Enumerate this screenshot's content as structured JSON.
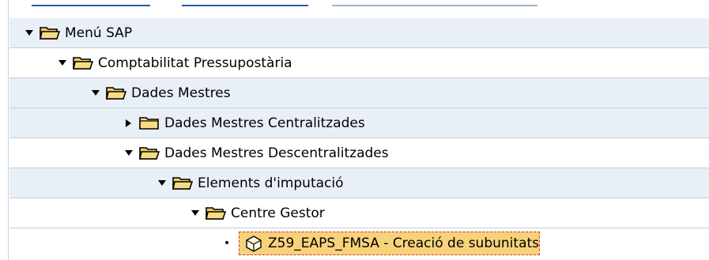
{
  "tree": {
    "items": [
      {
        "label": "Menú SAP",
        "state": "expanded",
        "icon": "folder-open-icon"
      },
      {
        "label": "Comptabilitat Pressupostària",
        "state": "expanded",
        "icon": "folder-open-icon"
      },
      {
        "label": "Dades Mestres",
        "state": "expanded",
        "icon": "folder-open-icon"
      },
      {
        "label": "Dades Mestres Centralitzades",
        "state": "collapsed",
        "icon": "folder-closed-icon"
      },
      {
        "label": "Dades Mestres Descentralitzades",
        "state": "expanded",
        "icon": "folder-open-icon"
      },
      {
        "label": "Elements d'imputació",
        "state": "expanded",
        "icon": "folder-open-icon"
      },
      {
        "label": "Centre Gestor",
        "state": "expanded",
        "icon": "folder-open-icon"
      },
      {
        "label": "Z59_EAPS_FMSA - Creació de subunitats",
        "state": "leaf",
        "icon": "transaction-icon",
        "selected": true
      }
    ]
  },
  "colors": {
    "row_shade": "#e9eff6",
    "row_border": "#c3cfdb",
    "selection_fill": "#f7d27a",
    "selection_border": "#d63a2a"
  }
}
